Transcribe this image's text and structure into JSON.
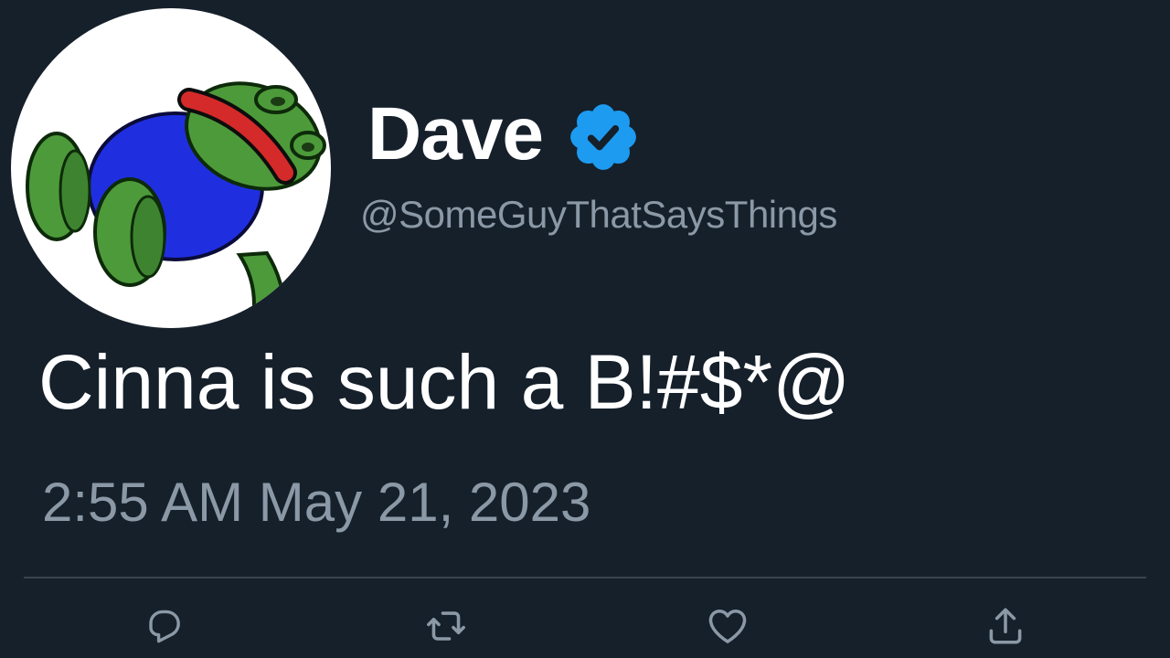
{
  "tweet": {
    "display_name": "Dave",
    "handle": "@SomeGuyThatSaysThings",
    "text": "Cinna is such a B!#$*@",
    "timestamp": "2:55 AM May 21, 2023",
    "verified": true
  },
  "icons": {
    "avatar": "frog-avatar",
    "verified": "verified-badge-icon",
    "reply": "reply-icon",
    "retweet": "retweet-icon",
    "like": "heart-icon",
    "share": "share-icon"
  },
  "colors": {
    "background": "#15202b",
    "text_primary": "#ffffff",
    "text_secondary": "#8b98a5",
    "verified": "#1d9bf0",
    "divider": "#38444d"
  }
}
